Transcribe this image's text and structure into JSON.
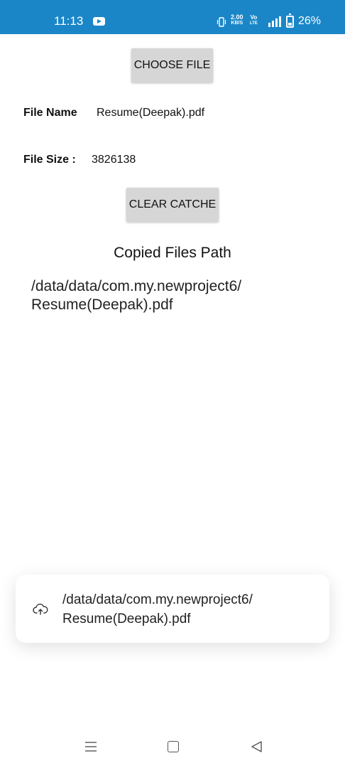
{
  "status_bar": {
    "time": "11:13",
    "net_speed_value": "2.00",
    "net_speed_unit": "KB/S",
    "volte_top": "Vo",
    "volte_bottom": "LTE",
    "battery": "26%",
    "icons": [
      "youtube-icon",
      "vibrate-icon",
      "signal-icon",
      "battery-icon"
    ],
    "color": "#1a86c8"
  },
  "buttons": {
    "choose_file": "CHOOSE FILE",
    "clear_cache": "CLEAR CATCHE"
  },
  "file_info": {
    "name_label": "File Name",
    "name_value": "Resume(Deepak).pdf",
    "size_label": "File Size :",
    "size_value": "3826138"
  },
  "copied": {
    "title": "Copied Files Path",
    "path_line1": "/data/data/com.my.newproject6/",
    "path_line2": "Resume(Deepak).pdf"
  },
  "toast": {
    "icon": "cloud-upload-icon",
    "line1": "/data/data/com.my.newproject6/",
    "line2": "Resume(Deepak).pdf"
  },
  "nav_bar": {
    "icons": [
      "menu-icon",
      "home-icon",
      "back-icon"
    ]
  }
}
